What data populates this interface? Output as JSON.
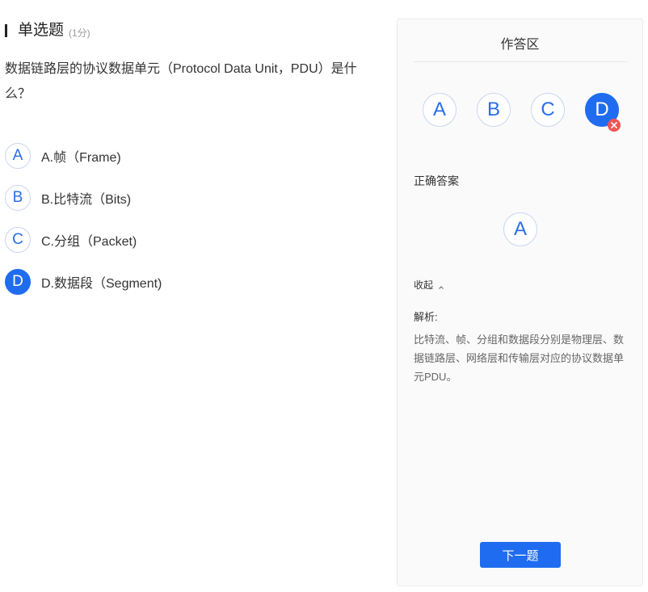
{
  "question": {
    "type_label": "单选题",
    "score": "(1分)",
    "stem": "数据链路层的协议数据单元（Protocol Data Unit，PDU）是什么？",
    "options": [
      {
        "letter": "A",
        "text": "A.帧（Frame)",
        "selected": false
      },
      {
        "letter": "B",
        "text": "B.比特流（Bits)",
        "selected": false
      },
      {
        "letter": "C",
        "text": "C.分组（Packet)",
        "selected": false
      },
      {
        "letter": "D",
        "text": "D.数据段（Segment)",
        "selected": true
      }
    ]
  },
  "panel": {
    "title": "作答区",
    "answer_letters": [
      "A",
      "B",
      "C",
      "D"
    ],
    "selected_answer": "D",
    "selected_answer_status": "wrong",
    "correct_label": "正确答案",
    "correct_answer": "A",
    "collapse_label": "收起",
    "analysis_label": "解析:",
    "analysis_text": "比特流、帧、分组和数据段分别是物理层、数据链路层、网络层和传输层对应的协议数据单元PDU。",
    "next_button": "下一题"
  },
  "colors": {
    "accent": "#1f6cf0",
    "wrong": "#f05454",
    "panel_bg": "#fafafa"
  },
  "icons": {
    "wrong_badge": "close-icon",
    "collapse": "chevron-up-icon"
  }
}
